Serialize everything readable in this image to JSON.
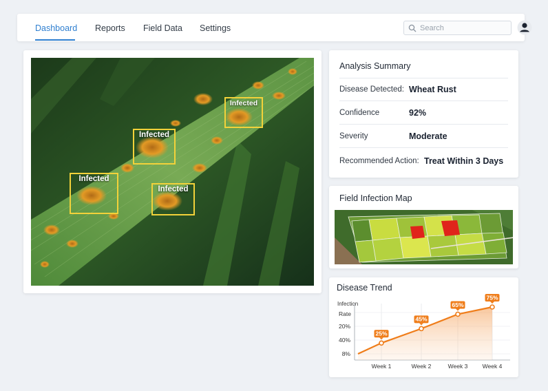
{
  "nav": {
    "tabs": [
      {
        "label": "Dashboard",
        "active": true
      },
      {
        "label": "Reports",
        "active": false
      },
      {
        "label": "Field Data",
        "active": false
      },
      {
        "label": "Settings",
        "active": false
      }
    ],
    "search_placeholder": "Search",
    "accent_color": "#2f7fd0"
  },
  "detection": {
    "boxes": [
      {
        "label": "Infected"
      },
      {
        "label": "Infected"
      },
      {
        "label": "Infected"
      },
      {
        "label": "Infected"
      }
    ],
    "box_color": "#f3d23a"
  },
  "summary": {
    "title": "Analysis Summary",
    "rows": [
      {
        "label": "Disease Detected:",
        "value": "Wheat Rust"
      },
      {
        "label": "Confidence",
        "value": "92%"
      },
      {
        "label": "Severity",
        "value": "Moderate"
      },
      {
        "label": "Recommended Action:",
        "value": "Treat Within 3 Days"
      }
    ]
  },
  "map": {
    "title": "Field Infection Map"
  },
  "trend": {
    "title": "Disease Trend"
  },
  "chart_data": {
    "type": "line",
    "title": "Disease Trend",
    "ylabel": "Infection Rate",
    "xlabel": "",
    "categories": [
      "Week 1",
      "Week 2",
      "Week 3",
      "Week 4"
    ],
    "y_ticks": [
      "8%",
      "40%",
      "20%"
    ],
    "series": [
      {
        "values": [
          10,
          25,
          45,
          65,
          75
        ],
        "point_labels": [
          "",
          "25%",
          "45%",
          "65%",
          "75%"
        ]
      }
    ],
    "line_color": "#ef7d1a",
    "grid": true
  }
}
